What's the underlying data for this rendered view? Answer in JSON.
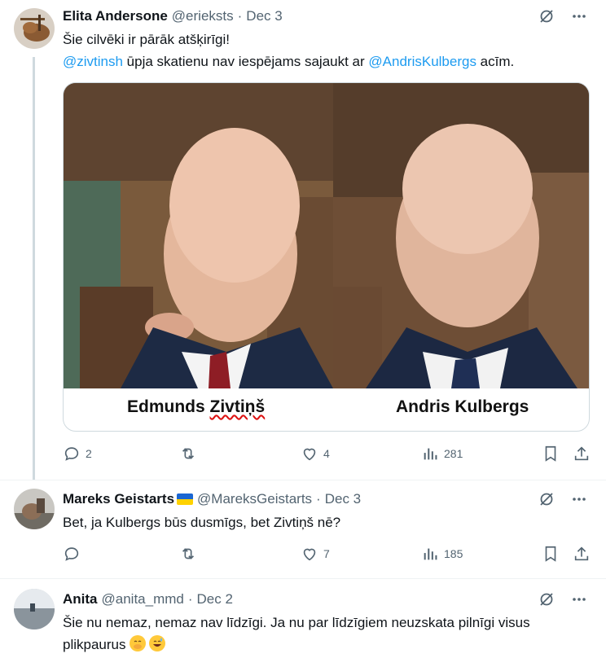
{
  "tweets": [
    {
      "name": "Elita Andersone",
      "handle": "@erieksts",
      "date": "Dec 3",
      "line1": "Šie cilvēki ir pārāk atšķirīgi!",
      "mention1": "@zivtinsh",
      "mid_text": " ūpja skatienu nav iespējams sajaukt ar ",
      "mention2": "@AndrisKulbergs",
      "end_text": " acīm.",
      "media": {
        "left_caption": "Edmunds Zivtiņš",
        "right_caption": "Andris Kulbergs"
      },
      "stats": {
        "replies": "2",
        "reposts": "",
        "likes": "4",
        "views": "281"
      }
    },
    {
      "name": "Mareks Geistarts",
      "handle": "@MareksGeistarts",
      "date": "Dec 3",
      "text": "Bet, ja Kulbergs būs dusmīgs, bet Zivtiņš nē?",
      "stats": {
        "replies": "",
        "reposts": "",
        "likes": "7",
        "views": "185"
      }
    },
    {
      "name": "Anita",
      "handle": "@anita_mmd",
      "date": "Dec 2",
      "text": "Šie nu nemaz, nemaz nav līdzīgi. Ja nu par līdzīgiem neuzskata pilnīgi visus plikpaurus"
    }
  ],
  "separator": "·",
  "icons": {
    "grok": "grok-icon",
    "more": "more-icon",
    "reply": "reply-icon",
    "repost": "repost-icon",
    "like": "like-icon",
    "views": "views-icon",
    "bookmark": "bookmark-icon",
    "share": "share-icon"
  },
  "colors": {
    "link": "#1d9bf0",
    "muted": "#536471",
    "thread_line": "#cfd9de"
  }
}
